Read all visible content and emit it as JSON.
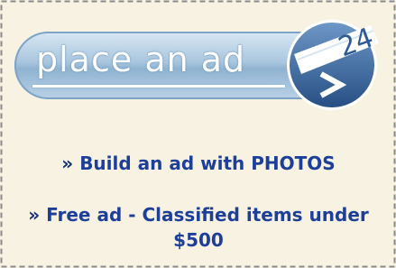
{
  "banner": {
    "label": "place an ad",
    "badge_number": "24",
    "arrow_icon": "chevron-right-icon"
  },
  "links": [
    {
      "bullet": "»",
      "text": "Build an ad with PHOTOS"
    },
    {
      "bullet": "»",
      "text": "Free ad - Classified items under $500"
    }
  ],
  "colors": {
    "panel_background": "#f7f2e1",
    "border": "#8a8a8a",
    "link": "#1d3f9a",
    "banner_blue": "#8fb3d1",
    "circle_blue": "#3d6fa6"
  }
}
